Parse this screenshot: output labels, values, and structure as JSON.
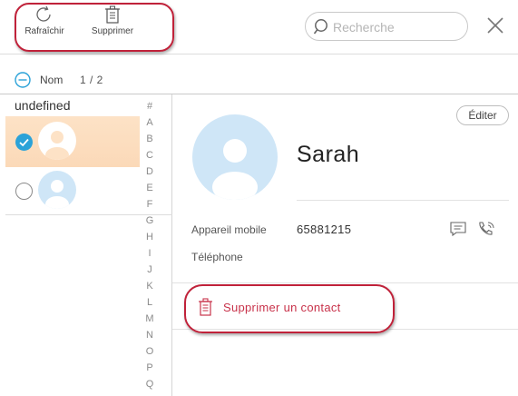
{
  "toolbar": {
    "refresh_label": "Rafraîchir",
    "delete_label": "Supprimer"
  },
  "search": {
    "placeholder": "Recherche",
    "value": ""
  },
  "sort": {
    "label": "Nom",
    "count": "1 / 2"
  },
  "list": {
    "group_header": "undefined",
    "contacts": [
      {
        "selected": true
      },
      {
        "selected": false
      }
    ]
  },
  "alphabet": [
    "#",
    "A",
    "B",
    "C",
    "D",
    "E",
    "F",
    "G",
    "H",
    "I",
    "J",
    "K",
    "L",
    "M",
    "N",
    "O",
    "P",
    "Q"
  ],
  "detail": {
    "edit_label": "Éditer",
    "name": "Sarah",
    "fields": [
      {
        "label": "Appareil mobile",
        "value": "65881215"
      },
      {
        "label": "Téléphone",
        "value": ""
      }
    ],
    "delete_contact_label": "Supprimer un contact"
  },
  "colors": {
    "accent_blue": "#2ba2d8",
    "selected_row": "#fde2c6",
    "avatar_bg": "#cfe6f7",
    "danger": "#c8324a",
    "annotation": "#c0223a"
  },
  "icons": {
    "refresh": "refresh-icon",
    "trash": "trash-icon",
    "search": "search-icon",
    "close": "close-icon",
    "sort": "minus-circle-icon",
    "message": "message-icon",
    "call": "phone-call-icon"
  }
}
